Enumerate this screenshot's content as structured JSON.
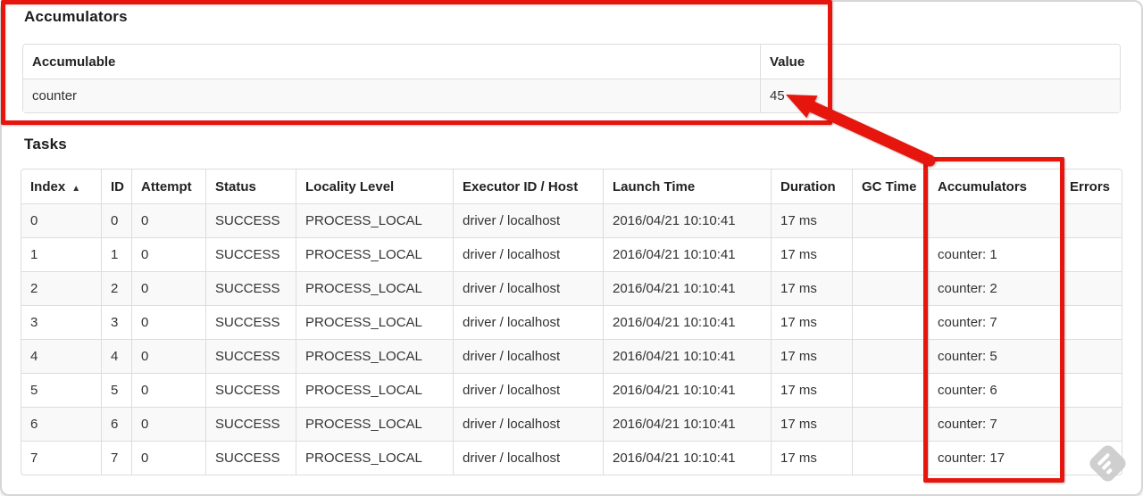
{
  "colors": {
    "annotation_red": "#e6150e",
    "table_border": "#dddddd",
    "row_stripe": "#f9f9f9",
    "text": "#333333"
  },
  "accumulators_section": {
    "heading": "Accumulators",
    "table": {
      "columns": [
        "Accumulable",
        "Value"
      ],
      "rows": [
        [
          "counter",
          "45"
        ]
      ]
    }
  },
  "tasks_section": {
    "heading": "Tasks",
    "table": {
      "columns": [
        {
          "label": "Index",
          "sort_icon": "▲"
        },
        "ID",
        "Attempt",
        "Status",
        "Locality Level",
        "Executor ID / Host",
        "Launch Time",
        "Duration",
        "GC Time",
        "Accumulators",
        "Errors"
      ],
      "rows": [
        [
          "0",
          "0",
          "0",
          "SUCCESS",
          "PROCESS_LOCAL",
          "driver / localhost",
          "2016/04/21 10:10:41",
          "17 ms",
          "",
          "",
          ""
        ],
        [
          "1",
          "1",
          "0",
          "SUCCESS",
          "PROCESS_LOCAL",
          "driver / localhost",
          "2016/04/21 10:10:41",
          "17 ms",
          "",
          "counter: 1",
          ""
        ],
        [
          "2",
          "2",
          "0",
          "SUCCESS",
          "PROCESS_LOCAL",
          "driver / localhost",
          "2016/04/21 10:10:41",
          "17 ms",
          "",
          "counter: 2",
          ""
        ],
        [
          "3",
          "3",
          "0",
          "SUCCESS",
          "PROCESS_LOCAL",
          "driver / localhost",
          "2016/04/21 10:10:41",
          "17 ms",
          "",
          "counter: 7",
          ""
        ],
        [
          "4",
          "4",
          "0",
          "SUCCESS",
          "PROCESS_LOCAL",
          "driver / localhost",
          "2016/04/21 10:10:41",
          "17 ms",
          "",
          "counter: 5",
          ""
        ],
        [
          "5",
          "5",
          "0",
          "SUCCESS",
          "PROCESS_LOCAL",
          "driver / localhost",
          "2016/04/21 10:10:41",
          "17 ms",
          "",
          "counter: 6",
          ""
        ],
        [
          "6",
          "6",
          "0",
          "SUCCESS",
          "PROCESS_LOCAL",
          "driver / localhost",
          "2016/04/21 10:10:41",
          "17 ms",
          "",
          "counter: 7",
          ""
        ],
        [
          "7",
          "7",
          "0",
          "SUCCESS",
          "PROCESS_LOCAL",
          "driver / localhost",
          "2016/04/21 10:10:41",
          "17 ms",
          "",
          "counter: 17",
          ""
        ]
      ]
    }
  },
  "annotations": {
    "accumulators_section_box": {
      "shape": "rectangle"
    },
    "accumulators_column_box": {
      "shape": "rectangle"
    },
    "arrow": {
      "points_to": "45"
    }
  },
  "watermark": {
    "icon": "feedly"
  }
}
